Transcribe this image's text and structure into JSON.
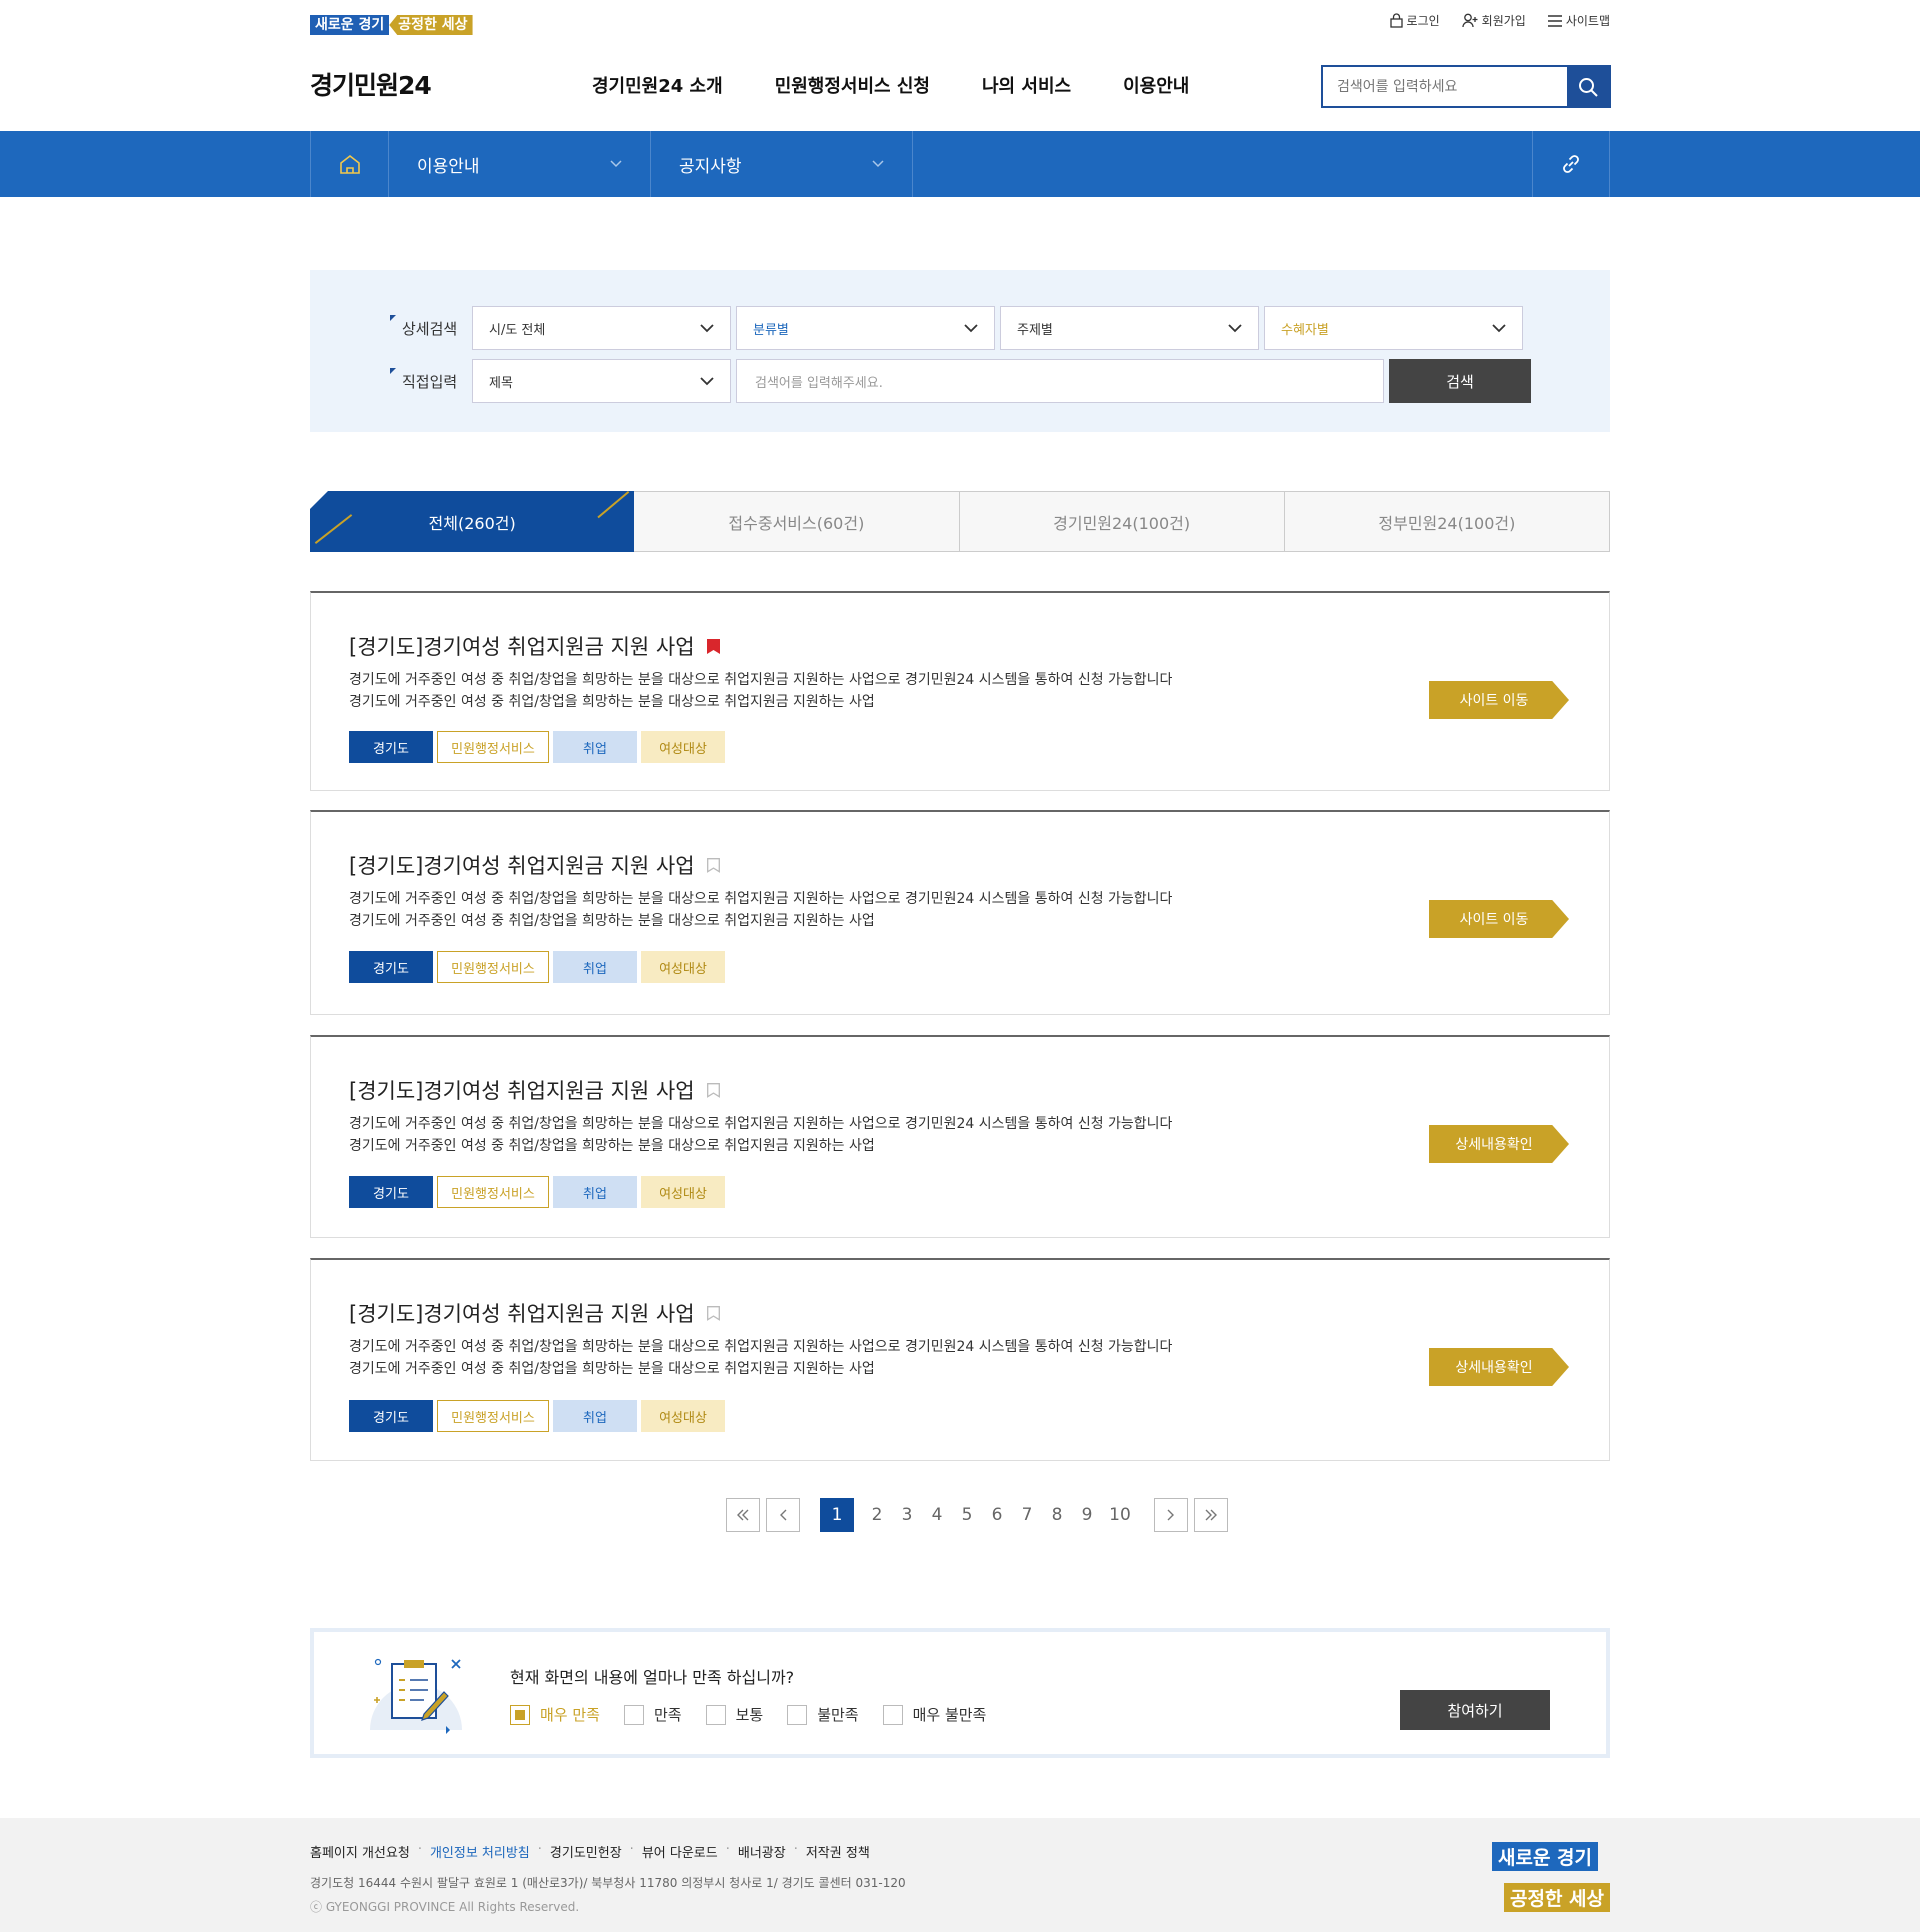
{
  "header": {
    "slogan_a": "새로운 경기",
    "slogan_b": "공정한 세상",
    "util": [
      "로그인",
      "회원가입",
      "사이트맵"
    ],
    "logo": "경기민원24",
    "gnb": [
      "경기민원24 소개",
      "민원행정서비스 신청",
      "나의 서비스",
      "이용안내"
    ],
    "search_placeholder": "검색어를 입력하세요"
  },
  "location": {
    "menu1": "이용안내",
    "menu2": "공지사항"
  },
  "filter": {
    "label1": "상세검색",
    "label2": "직접입력",
    "selects": [
      "시/도 전체",
      "분류별",
      "주제별",
      "수혜자별"
    ],
    "field_select": "제목",
    "input_placeholder": "검색어를 입력해주세요.",
    "search_button": "검색"
  },
  "tabs": [
    "전체(260건)",
    "접수중서비스(60건)",
    "경기민원24(100건)",
    "정부민원24(100건)"
  ],
  "cards": [
    {
      "title": "[경기도]경기여성 취업지원금 지원 사업",
      "line1": "경기도에 거주중인 여성 중 취업/창업을 희망하는 분을 대상으로 취업지원금 지원하는 사업으로 경기민원24 시스템을 통하여 신청 가능합니다",
      "line2": "경기도에 거주중인 여성 중 취업/창업을 희망하는 분을 대상으로 취업지원금 지원하는 사업",
      "tags": [
        "경기도",
        "민원행정서비스",
        "취업",
        "여성대상"
      ],
      "button": "사이트 이동",
      "bookmarked": true
    },
    {
      "title": "[경기도]경기여성 취업지원금 지원 사업",
      "line1": "경기도에 거주중인 여성 중 취업/창업을 희망하는 분을 대상으로 취업지원금 지원하는 사업으로 경기민원24 시스템을 통하여 신청 가능합니다",
      "line2": "경기도에 거주중인 여성 중 취업/창업을 희망하는 분을 대상으로 취업지원금 지원하는 사업",
      "tags": [
        "경기도",
        "민원행정서비스",
        "취업",
        "여성대상"
      ],
      "button": "사이트 이동",
      "bookmarked": false
    },
    {
      "title": "[경기도]경기여성 취업지원금 지원 사업",
      "line1": "경기도에 거주중인 여성 중 취업/창업을 희망하는 분을 대상으로 취업지원금 지원하는 사업으로 경기민원24 시스템을 통하여 신청 가능합니다",
      "line2": "경기도에 거주중인 여성 중 취업/창업을 희망하는 분을 대상으로 취업지원금 지원하는 사업",
      "tags": [
        "경기도",
        "민원행정서비스",
        "취업",
        "여성대상"
      ],
      "button": "상세내용확인",
      "bookmarked": false
    },
    {
      "title": "[경기도]경기여성 취업지원금 지원 사업",
      "line1": "경기도에 거주중인 여성 중 취업/창업을 희망하는 분을 대상으로 취업지원금 지원하는 사업으로 경기민원24 시스템을 통하여 신청 가능합니다",
      "line2": "경기도에 거주중인 여성 중 취업/창업을 희망하는 분을 대상으로 취업지원금 지원하는 사업",
      "tags": [
        "경기도",
        "민원행정서비스",
        "취업",
        "여성대상"
      ],
      "button": "상세내용확인",
      "bookmarked": false
    }
  ],
  "pagination": {
    "pages": [
      "1",
      "2",
      "3",
      "4",
      "5",
      "6",
      "7",
      "8",
      "9",
      "10"
    ],
    "current": "1"
  },
  "survey": {
    "question": "현재 화면의 내용에 얼마나 만족 하십니까?",
    "options": [
      "매우 만족",
      "만족",
      "보통",
      "불만족",
      "매우 불만족"
    ],
    "selected": "매우 만족",
    "button": "참여하기"
  },
  "footer": {
    "links": [
      "홈페이지 개선요청",
      "개인정보 처리방침",
      "경기도민헌장",
      "뷰어 다운로드",
      "배너광장",
      "저작권 정책"
    ],
    "address": "경기도청 16444 수원시 팔달구 효원로 1 (매산로3가)/ 북부청사 11780 의정부시 청사로 1/ 경기도 콜센터 031-120",
    "copyright": "ⓒ GYEONGGI PROVINCE All Rights Reserved.",
    "logo_a": "새로운 경기",
    "logo_b": "공정한 세상"
  },
  "colors": {
    "primary": "#1e68bd",
    "navy": "#0f4c9c",
    "gold": "#c9a227"
  }
}
